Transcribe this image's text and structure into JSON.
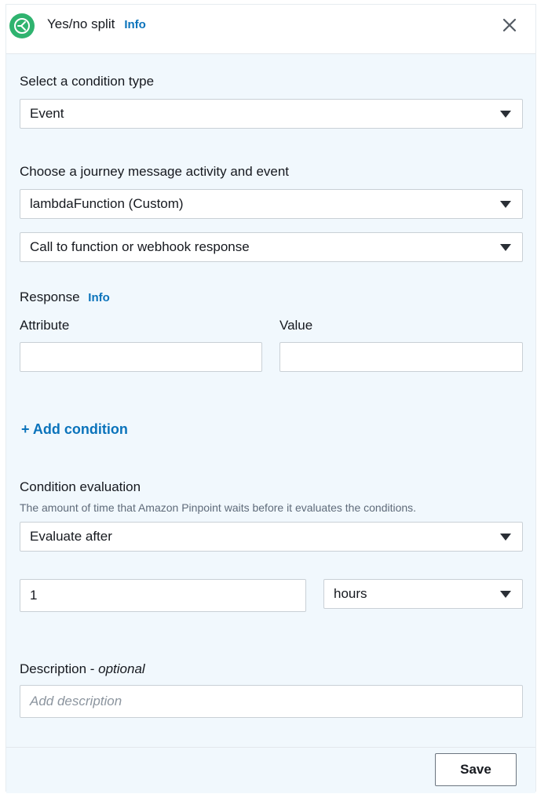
{
  "header": {
    "title": "Yes/no split",
    "info_label": "Info",
    "icon": "split-icon",
    "close_icon": "close-icon"
  },
  "condition_type": {
    "label": "Select a condition type",
    "selected": "Event"
  },
  "journey_activity": {
    "label": "Choose a journey message activity and event",
    "activity_selected": "lambdaFunction (Custom)",
    "event_selected": "Call to function or webhook response"
  },
  "response": {
    "label": "Response",
    "info_label": "Info",
    "attribute_label": "Attribute",
    "attribute_value": "",
    "value_label": "Value",
    "value_value": ""
  },
  "add_condition_label": "+ Add condition",
  "condition_evaluation": {
    "label": "Condition evaluation",
    "hint": "The amount of time that Amazon Pinpoint waits before it evaluates the conditions.",
    "mode_selected": "Evaluate after",
    "amount_value": "1",
    "unit_selected": "hours"
  },
  "description": {
    "label": "Description - ",
    "label_suffix": "optional",
    "placeholder": "Add description"
  },
  "footer": {
    "save_label": "Save"
  },
  "colors": {
    "accent": "#0a73bb",
    "icon_green": "#2fb36f",
    "panel_bg": "#f1f8fd"
  }
}
